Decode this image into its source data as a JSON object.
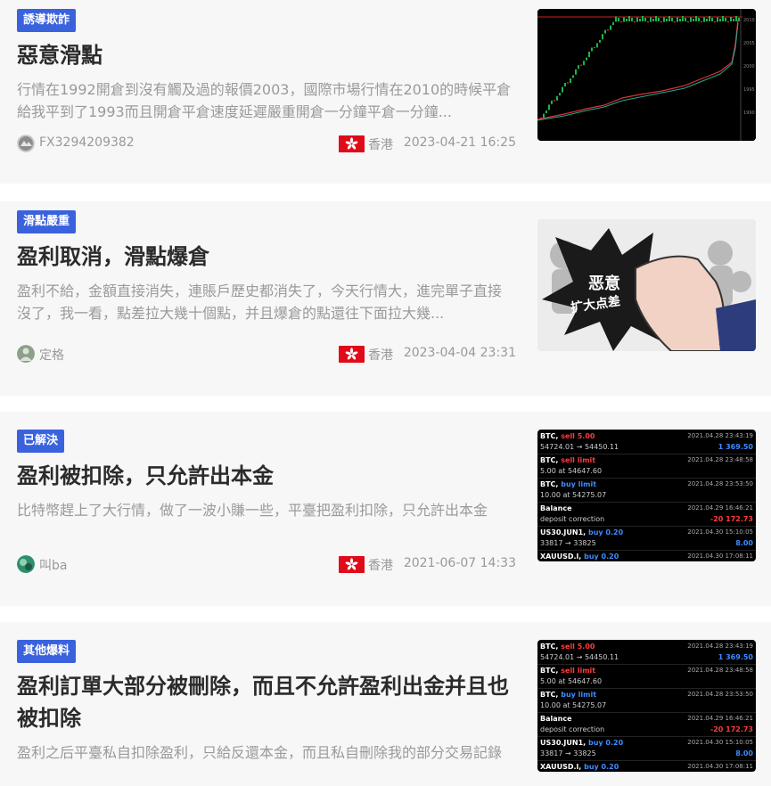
{
  "colors": {
    "badge": "#3b62dd",
    "card_bg": "#f7f7f8",
    "flag_red": "#e00b19",
    "loss": "#ff3b3b",
    "gain": "#3b8cff"
  },
  "posts": [
    {
      "badge": "誘導欺詐",
      "title": "惡意滑點",
      "excerpt": "行情在1992開倉到沒有觸及過的報價2003，國際市場行情在2010的時候平倉給我平到了1993而且開倉平倉速度延遲嚴重開倉一分鐘平倉一分鐘...",
      "user": "FX3294209382",
      "region": "香港",
      "date": "2023-04-21 16:25",
      "thumb_icon": "candlestick-chart-icon"
    },
    {
      "badge": "滑點嚴重",
      "title": "盈利取消，滑點爆倉",
      "excerpt": "盈利不給，金額直接消失，連賬戶歷史都消失了，今天行情大，進完單子直接沒了，我一看，點差拉大幾十個點，并且爆倉的點還往下面拉大幾...",
      "user": "定格",
      "region": "香港",
      "date": "2023-04-04 23:31",
      "thumb_text": {
        "line1": "恶意",
        "line2": "扩大点差"
      }
    },
    {
      "badge": "已解決",
      "title": "盈利被扣除，只允許出本金",
      "excerpt": "比特幣趕上了大行情，做了一波小賺一些，平臺把盈利扣除，只允許出本金",
      "user": "叫ba",
      "region": "香港",
      "date": "2021-06-07 14:33"
    },
    {
      "badge": "其他爆料",
      "title": "盈利訂單大部分被刪除，而且不允許盈利出金并且也被扣除",
      "excerpt": "盈利之后平臺私自扣除盈利，只給反還本金，而且私自刪除我的部分交易記錄",
      "user": "",
      "region": "",
      "date": ""
    }
  ],
  "trades": [
    {
      "sym": "BTC,",
      "op": "sell 5.00",
      "op_cls": "red",
      "detail": "54724.01 → 54450.11",
      "time": "2021.04.28 23:43:19",
      "val": "1 369.50",
      "val_cls": "blue"
    },
    {
      "sym": "BTC,",
      "op": "sell limit",
      "op_cls": "red",
      "detail": "5.00 at 54647.60",
      "time": "2021.04.28 23:48:58",
      "val": "",
      "val_cls": ""
    },
    {
      "sym": "BTC,",
      "op": "buy limit",
      "op_cls": "blue",
      "detail": "10.00 at 54275.07",
      "time": "2021.04.28 23:53:50",
      "val": "",
      "val_cls": ""
    },
    {
      "sym": "Balance",
      "op": "",
      "op_cls": "",
      "detail": "deposit correction",
      "time": "2021.04.29 16:46:21",
      "val": "-20 172.73",
      "val_cls": "red"
    },
    {
      "sym": "US30.JUN1,",
      "op": "buy 0.20",
      "op_cls": "blue",
      "detail": "33817 → 33825",
      "time": "2021.04.30 15:10:05",
      "val": "8.00",
      "val_cls": "blue"
    },
    {
      "sym": "XAUUSD.l,",
      "op": "buy 0.20",
      "op_cls": "blue",
      "detail": "",
      "time": "2021.04.30 17:08:11",
      "val": "",
      "val_cls": ""
    }
  ]
}
